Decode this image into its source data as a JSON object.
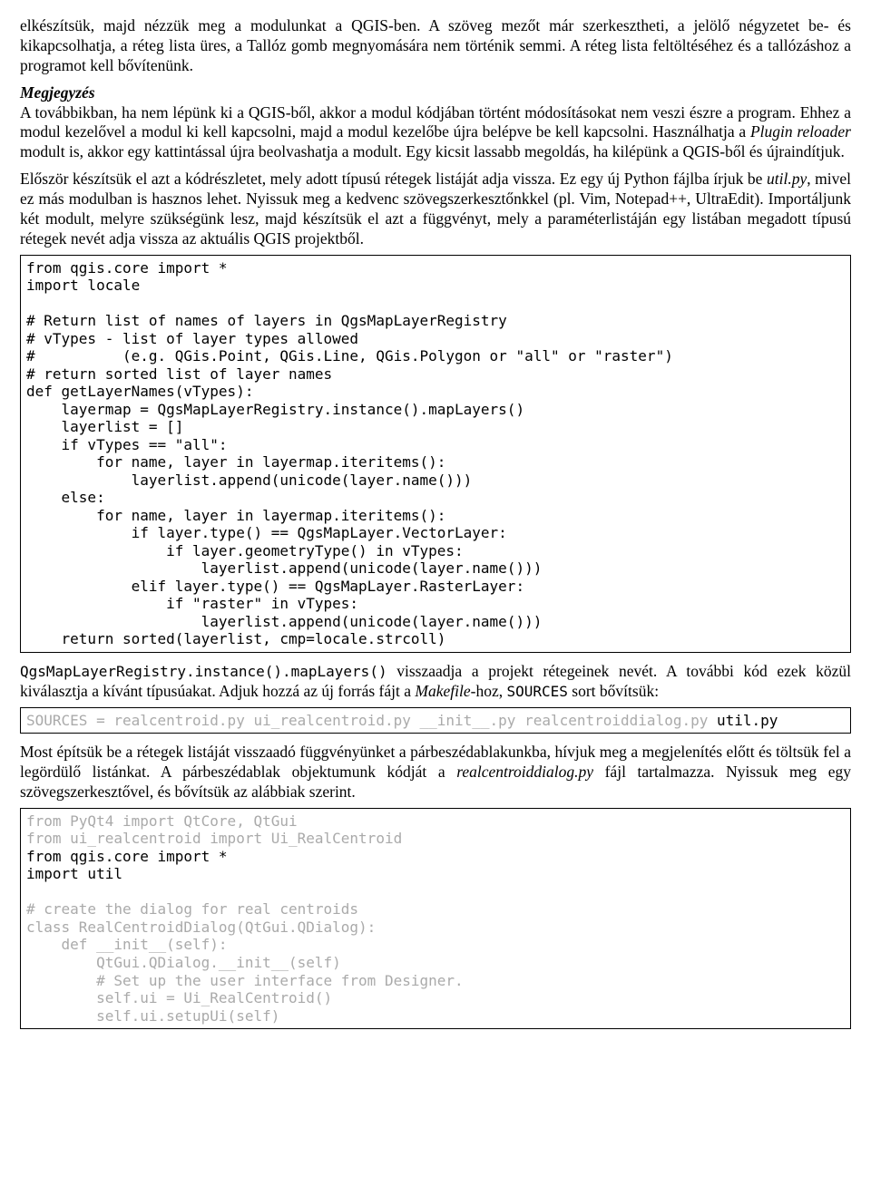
{
  "paragraphs": {
    "p1": "elkészítsük, majd nézzük meg a modulunkat a QGIS-ben. A szöveg mezőt már szerkesztheti, a jelölő négyzetet be- és kikapcsolhatja, a réteg lista üres, a Tallóz gomb megnyomására nem történik semmi. A réteg lista feltöltéséhez és a tallózáshoz a programot kell bővítenünk.",
    "note_heading": "Megjegyzés",
    "note_body_1": "A továbbikban, ha nem lépünk ki a QGIS-ből, akkor a modul kódjában történt módosításokat nem veszi észre a program. Ehhez a modul kezelővel a modul ki kell kapcsolni, majd a modul kezelőbe újra belépve be kell kapcsolni. Használhatja a ",
    "note_body_italic": "Plugin reloader",
    "note_body_2": " modult is, akkor egy kattintással újra beolvashatja a modult. Egy kicsit lassabb megoldás, ha kilépünk a QGIS-ből és újraindítjuk.",
    "p3_1": "Először készítsük el azt a kódrészletet, mely adott típusú rétegek listáját adja vissza. Ez egy új Python fájlba írjuk be ",
    "p3_italic": "util.py",
    "p3_2": ", mivel ez más modulban is hasznos lehet. Nyissuk meg a kedvenc szövegszerkesztőnkkel (pl. Vim, Notepad++, UltraEdit). Importáljunk két modult, melyre szükségünk lesz, majd készítsük el azt a függvényt, mely a paraméterlistáján egy listában megadott típusú rétegek nevét adja vissza az aktuális QGIS projektből.",
    "p4_mono": "QgsMapLayerRegistry.instance().mapLayers()",
    "p4_1": " visszaadja a projekt rétegeinek nevét. A további kód ezek közül kiválasztja a kívánt típusúakat. Adjuk hozzá az új forrás fájt a ",
    "p4_italic": "Makefile",
    "p4_2": "-hoz, ",
    "p4_mono2": "SOURCES",
    "p4_3": " sort bővítsük:",
    "p5_1": "Most építsük be a rétegek listáját visszaadó függvényünket a párbeszédablakunkba, hívjuk meg a megjelenítés előtt és töltsük fel a legördülő listánkat. A párbeszédablak objektumunk kódját a ",
    "p5_italic": "realcentroiddialog.py",
    "p5_2": " fájl tartalmazza. Nyissuk meg egy szövegszerkesztővel, és bővítsük az alábbiak szerint."
  },
  "code1": "from qgis.core import *\nimport locale\n\n# Return list of names of layers in QgsMapLayerRegistry\n# vTypes - list of layer types allowed\n#          (e.g. QGis.Point, QGis.Line, QGis.Polygon or \"all\" or \"raster\")\n# return sorted list of layer names\ndef getLayerNames(vTypes):\n    layermap = QgsMapLayerRegistry.instance().mapLayers()\n    layerlist = []\n    if vTypes == \"all\":\n        for name, layer in layermap.iteritems():\n            layerlist.append(unicode(layer.name()))\n    else:\n        for name, layer in layermap.iteritems():\n            if layer.type() == QgsMapLayer.VectorLayer:\n                if layer.geometryType() in vTypes:\n                    layerlist.append(unicode(layer.name()))\n            elif layer.type() == QgsMapLayer.RasterLayer:\n                if \"raster\" in vTypes:\n                    layerlist.append(unicode(layer.name()))\n    return sorted(layerlist, cmp=locale.strcoll)",
  "code2_gray": "SOURCES = realcentroid.py ui_realcentroid.py __init__.py realcentroiddialog.py ",
  "code2_black": "util.py",
  "code3": {
    "l1g": "from PyQt4 import QtCore, QtGui",
    "l2g": "from ui_realcentroid import Ui_RealCentroid",
    "l3b": "from qgis.core import *",
    "l4b": "import util",
    "l5": "",
    "l6g": "# create the dialog for real centroids",
    "l7g": "class RealCentroidDialog(QtGui.QDialog):",
    "l8g": "    def __init__(self):",
    "l9g": "        QtGui.QDialog.__init__(self)",
    "l10g": "        # Set up the user interface from Designer.",
    "l11g": "        self.ui = Ui_RealCentroid()",
    "l12g": "        self.ui.setupUi(self)"
  }
}
